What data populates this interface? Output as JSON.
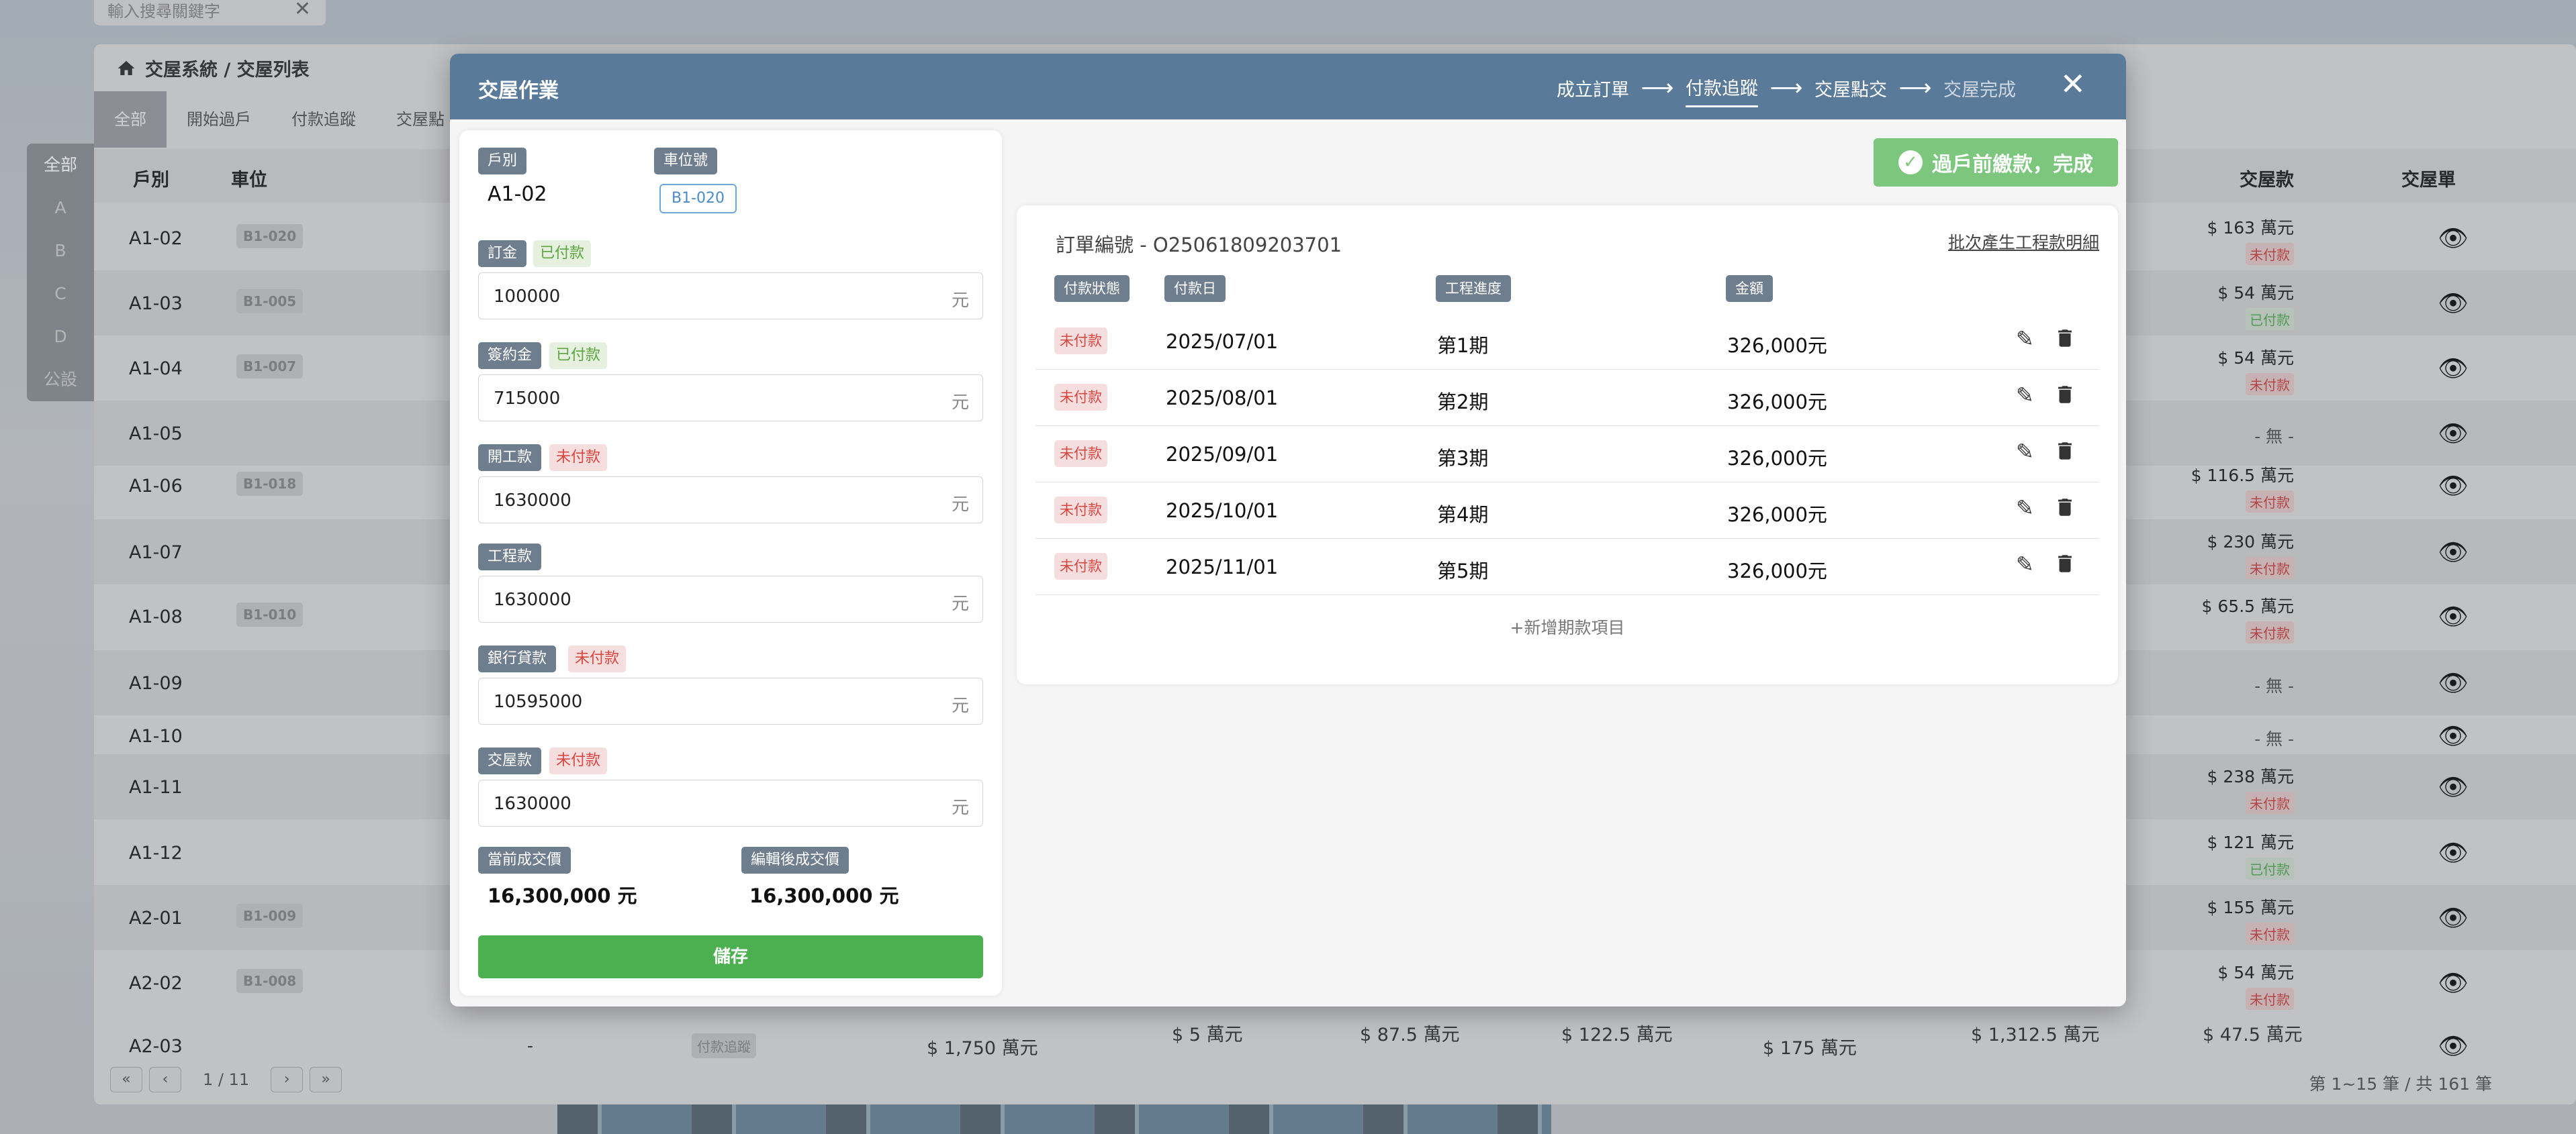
{
  "background": {
    "search_placeholder": "輸入搜尋關鍵字",
    "breadcrumb": "交屋系統 / 交屋列表",
    "tabs": [
      "全部",
      "開始過戶",
      "付款追蹤",
      "交屋點"
    ],
    "side_filters": [
      "全部",
      "A",
      "B",
      "C",
      "D",
      "公設"
    ],
    "columns": {
      "unit": "戶別",
      "parking": "車位",
      "delivery_payment": "交屋款",
      "delivery_sheet": "交屋單"
    },
    "rows": [
      {
        "unit": "A1-02",
        "parking": "B1-020",
        "amount": "$ 163 萬元",
        "status": "未付款",
        "paid": false
      },
      {
        "unit": "A1-03",
        "parking": "B1-005",
        "amount": "$ 54 萬元",
        "status": "已付款",
        "paid": true
      },
      {
        "unit": "A1-04",
        "parking": "B1-007",
        "amount": "$ 54 萬元",
        "status": "未付款",
        "paid": false
      },
      {
        "unit": "A1-05",
        "parking": "",
        "amount": "- 無 -",
        "status": "",
        "paid": false
      },
      {
        "unit": "A1-06",
        "parking": "B1-018",
        "amount": "$ 116.5 萬元",
        "status": "未付款",
        "paid": false
      },
      {
        "unit": "A1-07",
        "parking": "",
        "amount": "$ 230 萬元",
        "status": "未付款",
        "paid": false
      },
      {
        "unit": "A1-08",
        "parking": "B1-010",
        "amount": "$ 65.5 萬元",
        "status": "未付款",
        "paid": false
      },
      {
        "unit": "A1-09",
        "parking": "",
        "amount": "- 無 -",
        "status": "",
        "paid": false
      },
      {
        "unit": "A1-10",
        "parking": "",
        "amount": "- 無 -",
        "status": "",
        "paid": false
      },
      {
        "unit": "A1-11",
        "parking": "",
        "amount": "$ 238 萬元",
        "status": "未付款",
        "paid": false
      },
      {
        "unit": "A1-12",
        "parking": "",
        "amount": "$ 121 萬元",
        "status": "已付款",
        "paid": true
      },
      {
        "unit": "A2-01",
        "parking": "B1-009",
        "amount": "$ 155 萬元",
        "status": "未付款",
        "paid": false
      },
      {
        "unit": "A2-02",
        "parking": "B1-008",
        "amount": "$ 54 萬元",
        "status": "未付款",
        "paid": false
      }
    ],
    "last_row": {
      "unit": "A2-03",
      "parking": "-",
      "stage": "付款追蹤",
      "total": "$ 1,750 萬元",
      "c1": "$ 5 萬元",
      "c2": "$ 87.5 萬元",
      "c3": "$ 122.5 萬元",
      "c4": "$ 175 萬元",
      "c5": "$ 1,312.5 萬元",
      "c6": "$ 47.5 萬元"
    },
    "pager": {
      "page": "1 / 11",
      "summary": "第 1~15 筆 / 共 161 筆"
    }
  },
  "modal": {
    "title": "交屋作業",
    "steps": [
      "成立訂單",
      "付款追蹤",
      "交屋點交",
      "交屋完成"
    ],
    "left": {
      "unit_label": "戶別",
      "unit_value": "A1-02",
      "parking_label": "車位號",
      "parking_value": "B1-020",
      "deposit": {
        "label": "訂金",
        "status": "已付款",
        "value": "100000",
        "unit": "元"
      },
      "signing": {
        "label": "簽約金",
        "status": "已付款",
        "value": "715000",
        "unit": "元"
      },
      "start": {
        "label": "開工款",
        "status": "未付款",
        "value": "1630000",
        "unit": "元"
      },
      "construction": {
        "label": "工程款",
        "value": "1630000",
        "unit": "元"
      },
      "loan": {
        "label": "銀行貸款",
        "status": "未付款",
        "value": "10595000",
        "unit": "元"
      },
      "delivery": {
        "label": "交屋款",
        "status": "未付款",
        "value": "1630000",
        "unit": "元"
      },
      "current_price_label": "當前成交價",
      "current_price": "16,300,000 元",
      "edited_price_label": "編輯後成交價",
      "edited_price": "16,300,000 元",
      "save_label": "儲存"
    },
    "done_button": "過戶前繳款，完成",
    "right": {
      "order_no": "訂單編號 - O25061809203701",
      "batch_link": "批次產生工程款明細",
      "headers": {
        "status": "付款狀態",
        "date": "付款日",
        "progress": "工程進度",
        "amount": "金額"
      },
      "payments": [
        {
          "status": "未付款",
          "date": "2025/07/01",
          "progress": "第1期",
          "amount": "326,000元"
        },
        {
          "status": "未付款",
          "date": "2025/08/01",
          "progress": "第2期",
          "amount": "326,000元"
        },
        {
          "status": "未付款",
          "date": "2025/09/01",
          "progress": "第3期",
          "amount": "326,000元"
        },
        {
          "status": "未付款",
          "date": "2025/10/01",
          "progress": "第4期",
          "amount": "326,000元"
        },
        {
          "status": "未付款",
          "date": "2025/11/01",
          "progress": "第5期",
          "amount": "326,000元"
        }
      ],
      "add_item": "+新增期款項目"
    }
  },
  "colors": {
    "header": "#5a7a9a",
    "save": "#4caf50",
    "done": "#7cc77d",
    "unpaid": "#d9453f",
    "paid": "#5aa53f"
  }
}
